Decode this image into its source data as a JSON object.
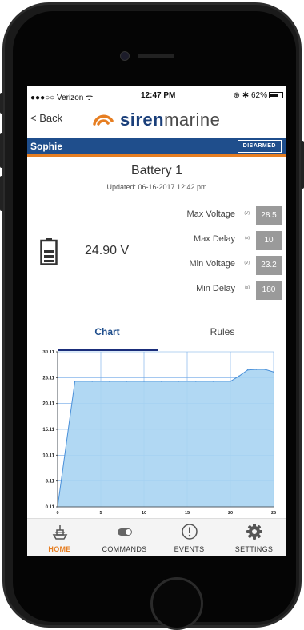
{
  "status_bar": {
    "carrier": "●●●○○ Verizon ᯤ",
    "time": "12:47 PM",
    "battery": "⊕ ✱ 62%"
  },
  "nav": {
    "back_label": "< Back",
    "logo_bold": "siren",
    "logo_light": "marine"
  },
  "header": {
    "user": "Sophie",
    "arm_state": "DISARMED"
  },
  "device": {
    "title": "Battery 1",
    "updated": "Updated: 06-16-2017 12:42 pm",
    "reading": "24.90 V"
  },
  "settings": [
    {
      "label": "Max Voltage",
      "unit": "(V)",
      "value": "28.5"
    },
    {
      "label": "Max Delay",
      "unit": "(s)",
      "value": "10"
    },
    {
      "label": "Min Voltage",
      "unit": "(V)",
      "value": "23.2"
    },
    {
      "label": "Min Delay",
      "unit": "(s)",
      "value": "180"
    }
  ],
  "tabs": {
    "chart": "Chart",
    "rules": "Rules",
    "active": "chart"
  },
  "chart_data": {
    "type": "area",
    "x": [
      0,
      2,
      4,
      6,
      8,
      10,
      12,
      14,
      16,
      18,
      20,
      21,
      22,
      23,
      24,
      25
    ],
    "y": [
      0.11,
      24.4,
      24.4,
      24.4,
      24.4,
      24.4,
      24.4,
      24.4,
      24.4,
      24.4,
      24.4,
      25.4,
      26.6,
      26.7,
      26.7,
      26.2
    ],
    "xticks": [
      0,
      5,
      10,
      15,
      20,
      25
    ],
    "xtick_labels": [
      "0",
      "5",
      "10",
      "15",
      "20",
      "25"
    ],
    "yticks": [
      0.11,
      5.11,
      10.11,
      15.11,
      20.11,
      25.11,
      30.11
    ],
    "ytick_labels": [
      "0.11",
      "5.11",
      "10.11",
      "15.11",
      "20.11",
      "25.11",
      "30.11"
    ],
    "xlim": [
      0,
      25
    ],
    "ylim": [
      0.11,
      30.11
    ],
    "grid": true,
    "fill_color": "#a9d4f2",
    "line_color": "#4a90d9"
  },
  "bottom_nav": [
    {
      "label": "HOME",
      "icon": "boat-icon",
      "active": true
    },
    {
      "label": "COMMANDS",
      "icon": "toggle-icon",
      "active": false
    },
    {
      "label": "EVENTS",
      "icon": "alert-icon",
      "active": false
    },
    {
      "label": "SETTINGS",
      "icon": "gear-icon",
      "active": false
    }
  ],
  "colors": {
    "brand_blue": "#1f4e8c",
    "brand_orange": "#e67e22",
    "value_box": "#9a9a9a"
  }
}
